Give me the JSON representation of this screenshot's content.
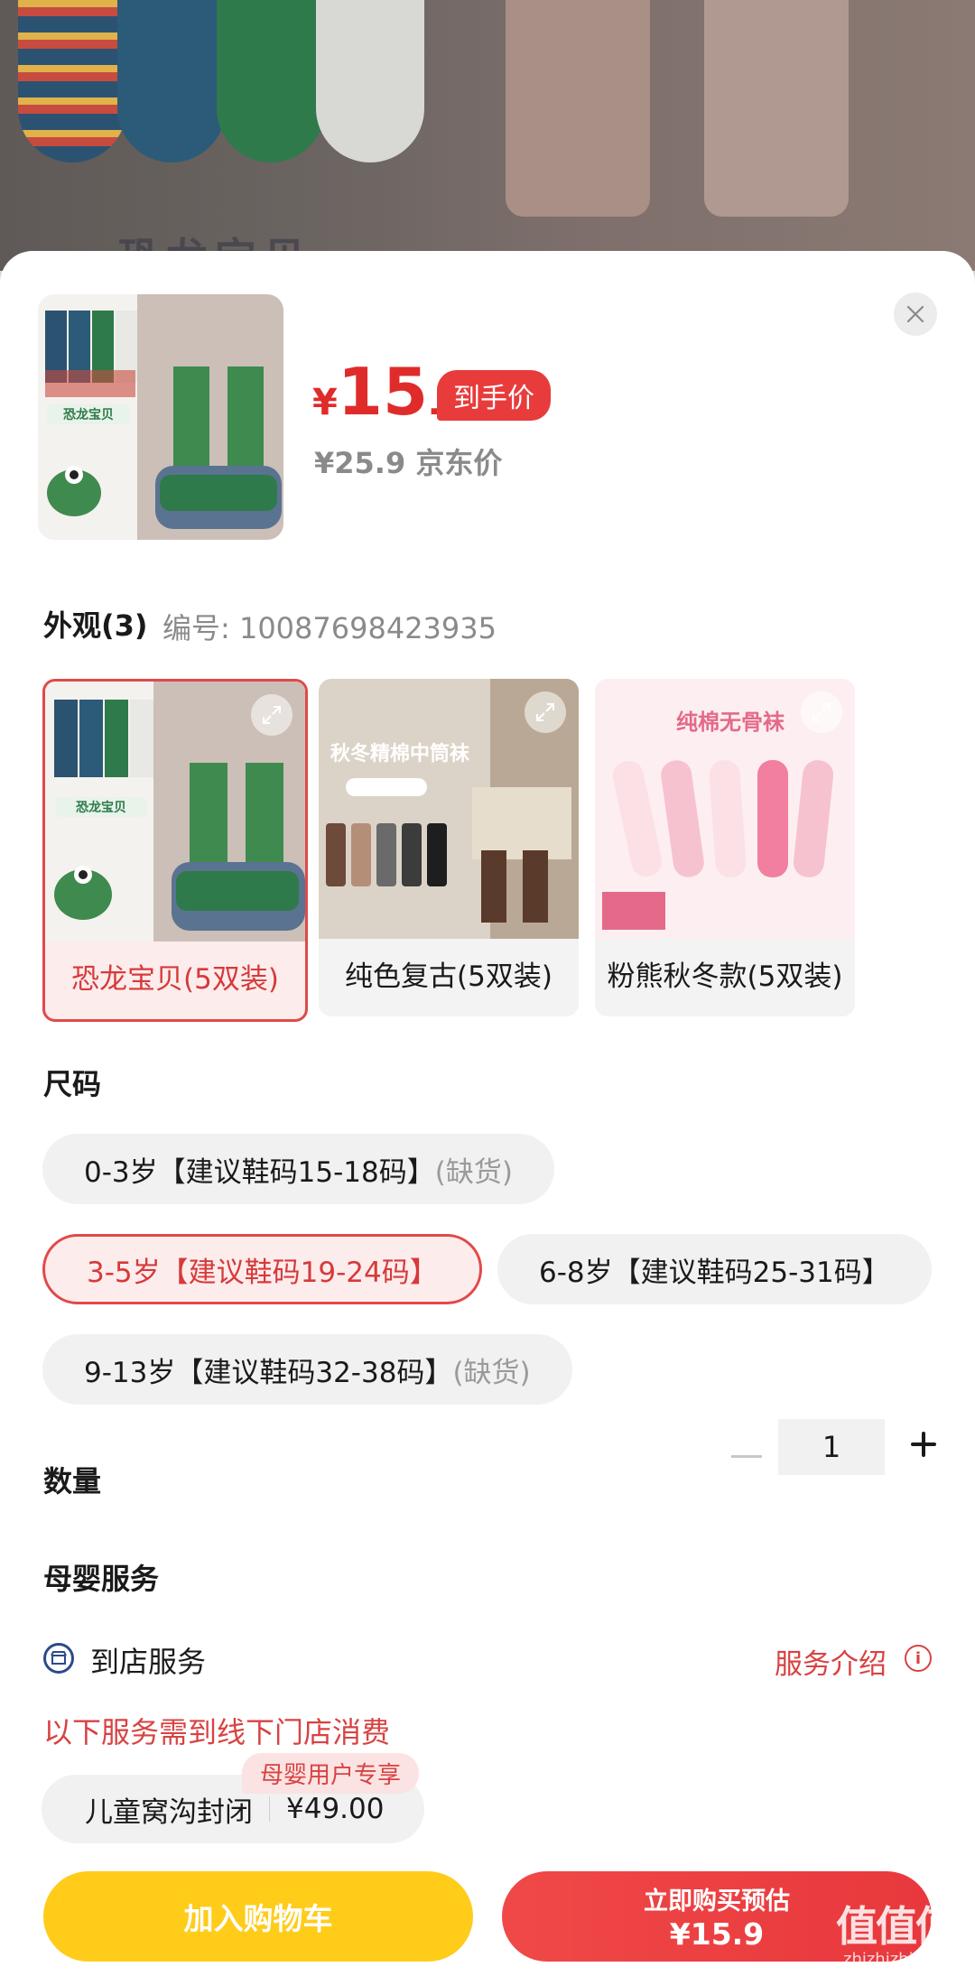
{
  "product": {
    "price_currency": "¥",
    "price_integer": "15",
    "price_decimal": ".9",
    "price_tag": "到手价",
    "jd_price": "¥25.9 京东价",
    "main_image_caption": "恐龙宝贝"
  },
  "appearance": {
    "title": "外观(3)",
    "sku_number": "编号: 10087698423935",
    "variants": [
      {
        "label": "恐龙宝贝(5双装)",
        "selected": true,
        "image_caption": "恐龙宝贝"
      },
      {
        "label": "纯色复古(5双装)",
        "selected": false,
        "image_caption": "秋冬精棉中筒袜"
      },
      {
        "label": "粉熊秋冬款(5双装)",
        "selected": false,
        "image_caption": "纯棉无骨袜"
      }
    ]
  },
  "size": {
    "title": "尺码",
    "options": [
      {
        "label": "0-3岁【建议鞋码15-18码】",
        "note": "(缺货)",
        "selected": false
      },
      {
        "label": "3-5岁【建议鞋码19-24码】",
        "note": "",
        "selected": true
      },
      {
        "label": "6-8岁【建议鞋码25-31码】",
        "note": "",
        "selected": false
      },
      {
        "label": "9-13岁【建议鞋码32-38码】",
        "note": "(缺货)",
        "selected": false
      }
    ]
  },
  "quantity": {
    "title": "数量",
    "value": "1"
  },
  "services": {
    "title": "母婴服务",
    "store_service": "到店服务",
    "service_intro": "服务介绍",
    "offline_note": "以下服务需到线下门店消费",
    "service_item_name": "儿童窝沟封闭",
    "service_item_price": "¥49.00",
    "service_badge": "母婴用户专享"
  },
  "actions": {
    "add_to_cart": "加入购物车",
    "buy_now_line1": "立即购买预估",
    "buy_now_line2": "¥15.9"
  },
  "watermark": {
    "main": "值值值",
    "sub": "zhizhizhi.com"
  },
  "colors": {
    "accent_red": "#e02b2b",
    "cart_yellow": "#ffcc1a",
    "chip_bg": "#f1f1f1"
  }
}
